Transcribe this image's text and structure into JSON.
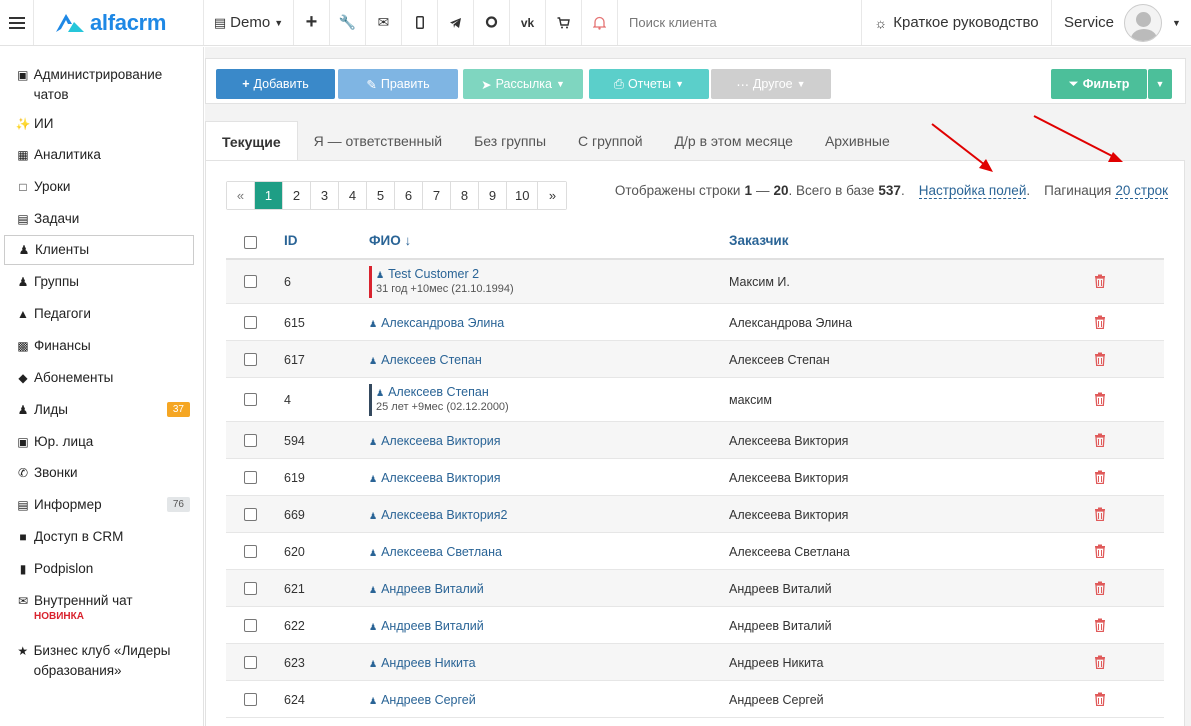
{
  "topbar": {
    "logo": "alfacrm",
    "branch": "Demo",
    "search_placeholder": "Поиск клиента",
    "guide": "Краткое руководство",
    "user": "Service"
  },
  "sidebar": {
    "items": [
      {
        "label": "Администрирование чатов",
        "icon": "chat-icon"
      },
      {
        "label": "ИИ",
        "icon": "sparkle-icon"
      },
      {
        "label": "Аналитика",
        "icon": "map-icon"
      },
      {
        "label": "Уроки",
        "icon": "calendar-icon"
      },
      {
        "label": "Задачи",
        "icon": "clipboard-icon"
      },
      {
        "label": "Клиенты",
        "icon": "user-icon"
      },
      {
        "label": "Группы",
        "icon": "users-icon"
      },
      {
        "label": "Педагоги",
        "icon": "graduation-cap-icon"
      },
      {
        "label": "Финансы",
        "icon": "money-icon"
      },
      {
        "label": "Абонементы",
        "icon": "tag-icon"
      },
      {
        "label": "Лиды",
        "icon": "user-plus-icon",
        "badge": "37"
      },
      {
        "label": "Юр. лица",
        "icon": "briefcase-icon"
      },
      {
        "label": "Звонки",
        "icon": "phone-icon"
      },
      {
        "label": "Информер",
        "icon": "newspaper-icon",
        "badge": "76"
      },
      {
        "label": "Доступ в CRM",
        "icon": "lock-icon"
      },
      {
        "label": "Podpislon",
        "icon": "document-icon"
      },
      {
        "label": "Внутренний чат",
        "icon": "envelope-icon",
        "tag": "НОВИНКА"
      },
      {
        "label": "Бизнес клуб «Лидеры образования»",
        "icon": "star-icon"
      }
    ]
  },
  "toolbar": {
    "add": "Добавить",
    "edit": "Править",
    "mailing": "Рассылка",
    "reports": "Отчеты",
    "other": "Другое",
    "filter": "Фильтр"
  },
  "tabs": [
    "Текущие",
    "Я — ответственный",
    "Без группы",
    "С группой",
    "Д/р в этом месяце",
    "Архивные"
  ],
  "pagination": {
    "prev": "«",
    "pages": [
      "1",
      "2",
      "3",
      "4",
      "5",
      "6",
      "7",
      "8",
      "9",
      "10"
    ],
    "next": "»",
    "current": "1"
  },
  "info": {
    "shown_prefix": "Отображены строки",
    "range_from": "1",
    "range_sep": "—",
    "range_to": "20",
    "total_prefix": ". Всего в базе",
    "total": "537",
    "fields_link": "Настройка полей",
    "pagination_label": "Пагинация",
    "per_page_link": "20 строк"
  },
  "table": {
    "headers": {
      "id": "ID",
      "name": "ФИО ↓",
      "customer": "Заказчик"
    },
    "rows": [
      {
        "id": "6",
        "name": "Test Customer 2",
        "sub": "31 год +10мес (21.10.1994)",
        "customer": "Максим И.",
        "bar": "#d9232e"
      },
      {
        "id": "615",
        "name": "Александрова Элина",
        "customer": "Александрова Элина"
      },
      {
        "id": "617",
        "name": "Алексеев Степан",
        "customer": "Алексеев Степан"
      },
      {
        "id": "4",
        "name": "Алексеев Степан",
        "sub": "25 лет +9мес (02.12.2000)",
        "customer": "максим",
        "bar": "#34495e"
      },
      {
        "id": "594",
        "name": "Алексеева Виктория",
        "customer": "Алексеева Виктория"
      },
      {
        "id": "619",
        "name": "Алексеева Виктория",
        "customer": "Алексеева Виктория"
      },
      {
        "id": "669",
        "name": "Алексеева Виктория2",
        "customer": "Алексеева Виктория"
      },
      {
        "id": "620",
        "name": "Алексеева Светлана",
        "customer": "Алексеева Светлана"
      },
      {
        "id": "621",
        "name": "Андреев Виталий",
        "customer": "Андреев Виталий"
      },
      {
        "id": "622",
        "name": "Андреев Виталий",
        "customer": "Андреев Виталий"
      },
      {
        "id": "623",
        "name": "Андреев Никита",
        "customer": "Андреев Никита"
      },
      {
        "id": "624",
        "name": "Андреев Сергей",
        "customer": "Андреев Сергей"
      }
    ]
  },
  "colors": {
    "accent": "#1e88e5",
    "link": "#2a6496",
    "active_page": "#1e9e85",
    "trash": "#e05a5a",
    "annotation_arrow": "#e00000"
  }
}
